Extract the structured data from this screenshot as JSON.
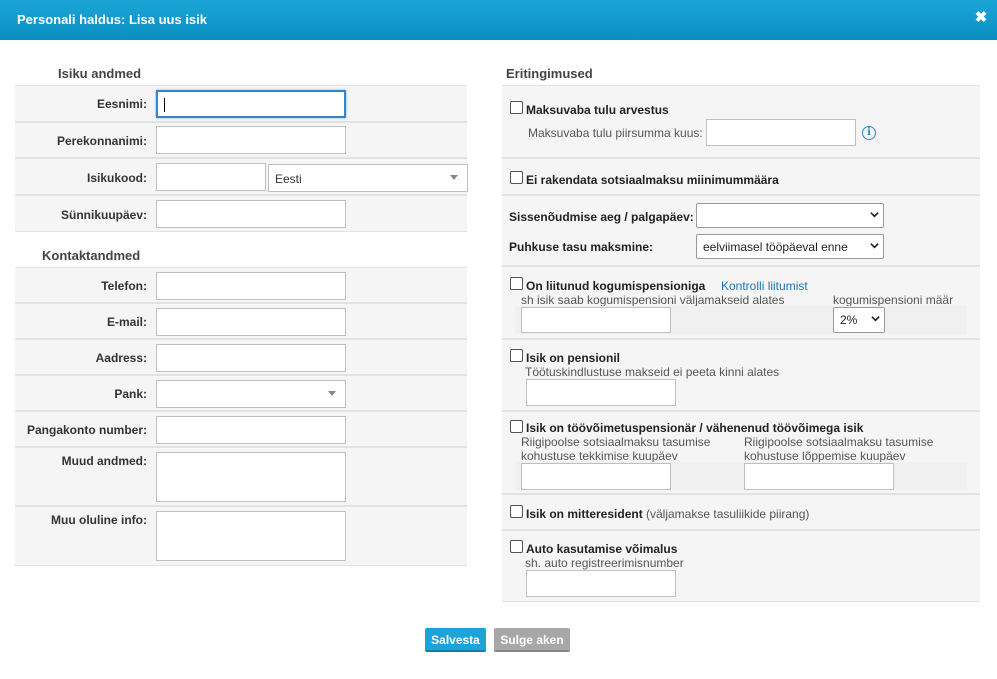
{
  "window": {
    "title": "Personali haldus: Lisa uus isik",
    "close_symbol": "✖"
  },
  "left": {
    "section_person": "Isiku andmed",
    "first_name": {
      "label": "Eesnimi:",
      "value": ""
    },
    "last_name": {
      "label": "Perekonnanimi:",
      "value": ""
    },
    "id_code": {
      "label": "Isikukood:",
      "value": "",
      "country": "Eesti"
    },
    "birth_date": {
      "label": "Sünnikuupäev:",
      "value": ""
    },
    "section_contact": "Kontaktandmed",
    "phone": {
      "label": "Telefon:",
      "value": ""
    },
    "email": {
      "label": "E-mail:",
      "value": ""
    },
    "address": {
      "label": "Aadress:",
      "value": ""
    },
    "bank": {
      "label": "Pank:",
      "value": ""
    },
    "account": {
      "label": "Pangakonto number:",
      "value": ""
    },
    "other_data": {
      "label": "Muud andmed:",
      "value": ""
    },
    "other_info": {
      "label": "Muu oluline info:",
      "value": ""
    }
  },
  "right": {
    "section_title": "Eritingimused",
    "taxfree": {
      "label": "Maksuvaba tulu arvestus",
      "sub": "Maksuvaba tulu piirsumma kuus:",
      "value": ""
    },
    "min_social": {
      "label": "Ei rakendata sotsiaalmaksu miinimummäära"
    },
    "claim_time": {
      "label": "Sissenõudmise aeg / palgapäev:",
      "value": ""
    },
    "holiday_pay": {
      "label": "Puhkuse tasu maksmine:",
      "value": "eelviimasel tööpäeval enne"
    },
    "pension": {
      "label": "On liitunud kogumispensioniga",
      "link": "Kontrolli liitumist",
      "sub1": "sh isik saab kogumispensioni väljamakseid alates",
      "sub2": "kogumispensioni määr",
      "rate": "2%",
      "value": ""
    },
    "pensioner": {
      "label": "Isik on pensionil",
      "sub": "Töötuskindlustuse makseid ei peeta kinni alates",
      "value": ""
    },
    "disability": {
      "label": "Isik on töövõimetuspensionär / vähenenud töövõimega isik",
      "sub1a": "Riigipoolse sotsiaalmaksu tasumise",
      "sub1b": "kohustuse tekkimise kuupäev",
      "sub2a": "Riigipoolse sotsiaalmaksu tasumise",
      "sub2b": "kohustuse lõppemise kuupäev"
    },
    "nonresident": {
      "label": "Isik on mitteresident",
      "note": "(väljamakse tasuliikide piirang)"
    },
    "car": {
      "label": "Auto kasutamise võimalus",
      "sub": "sh. auto registreerimisnumber",
      "value": ""
    }
  },
  "buttons": {
    "save": "Salvesta",
    "close": "Sulge aken"
  },
  "colors": {
    "titlebar": "#1aa6d6",
    "save": "#1ea3d8",
    "close": "#a7a7a7",
    "link": "#1a73b8"
  }
}
